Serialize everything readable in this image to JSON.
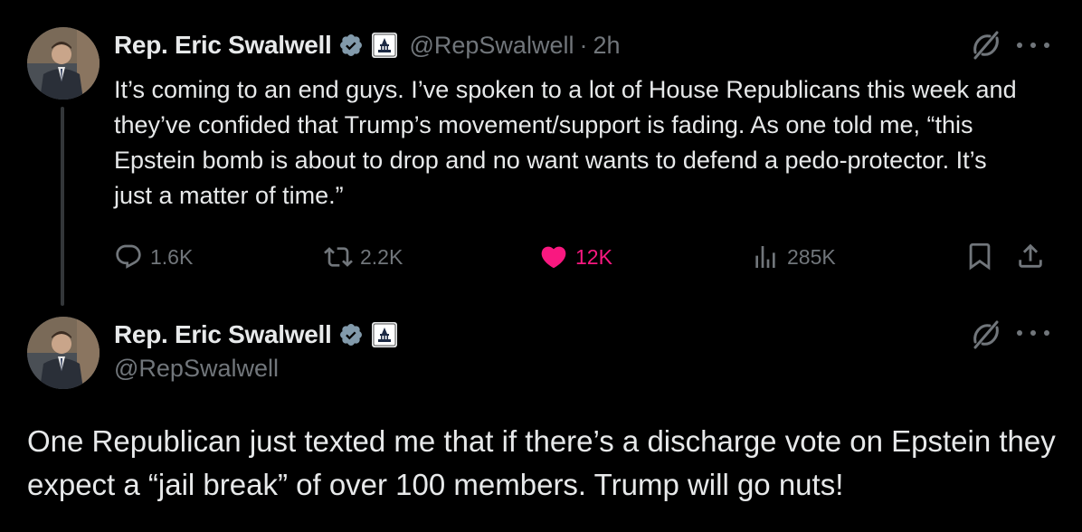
{
  "tweets": [
    {
      "name": "Rep. Eric Swalwell",
      "handle": "@RepSwalwell",
      "separator": "·",
      "time": "2h",
      "text": "It’s coming to an end guys. I’ve spoken to a lot of House Republicans this week and they’ve confided that Trump’s movement/support is fading. As one told me, “this Epstein bomb is about to drop and no want wants to defend a pedo-protector. It’s just a matter of time.”",
      "stats": {
        "replies": "1.6K",
        "reposts": "2.2K",
        "likes": "12K",
        "views": "285K"
      },
      "liked": true
    },
    {
      "name": "Rep. Eric Swalwell",
      "handle": "@RepSwalwell",
      "text": "One Republican just texted me that if there’s a discharge vote on Epstein they expect a “jail break” of over 100 members.  Trump will go nuts!"
    }
  ],
  "icons": {
    "verified": "verified-badge-icon",
    "government": "capitol-label-icon",
    "grok": "grok-icon",
    "more": "more-dots-icon",
    "reply": "reply-icon",
    "repost": "repost-icon",
    "like": "heart-icon",
    "views": "views-icon",
    "bookmark": "bookmark-icon",
    "share": "share-icon"
  },
  "colors": {
    "background": "#000000",
    "text": "#e7e9ea",
    "secondary": "#71767b",
    "like": "#f91880",
    "verified": "#829aab"
  }
}
